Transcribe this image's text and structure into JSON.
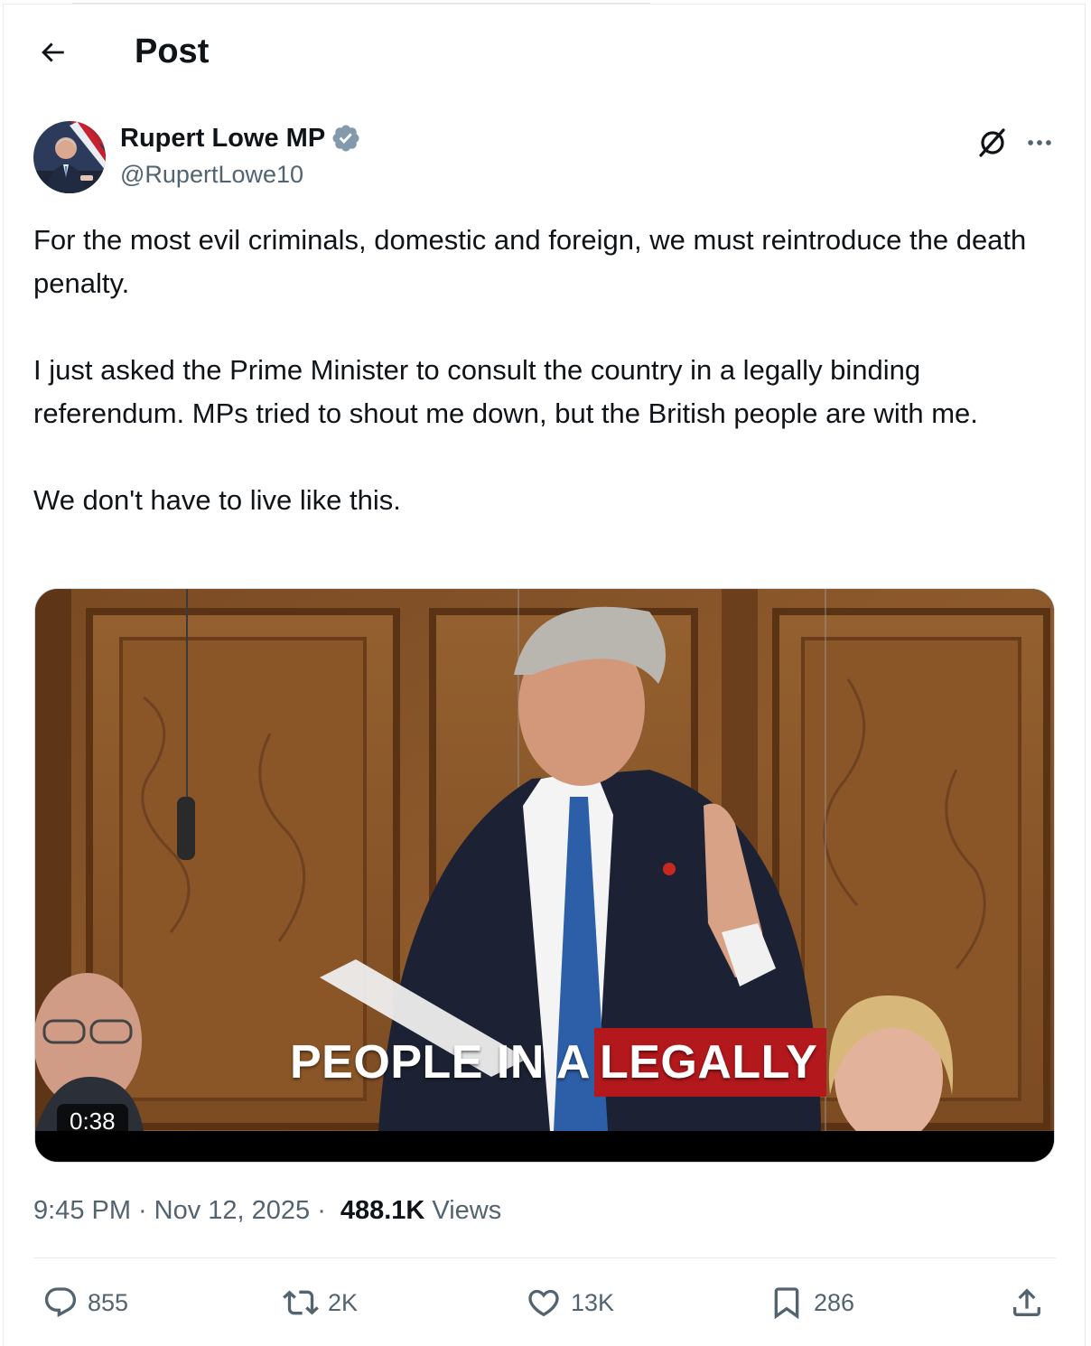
{
  "header": {
    "title": "Post",
    "back_icon": "arrow-left-icon"
  },
  "author": {
    "display_name": "Rupert Lowe MP",
    "handle": "@RupertLowe10",
    "verified_color": "#829aab"
  },
  "tweet": {
    "paragraphs": [
      "For the most evil criminals, domestic and foreign, we must reintroduce the death penalty.",
      "I just asked the Prime Minister to consult the country in a legally binding referendum. MPs tried to shout me down, but the British people are with me.",
      "We don't have to live like this."
    ]
  },
  "media": {
    "caption_plain": "PEOPLE IN A",
    "caption_highlight": "LEGALLY",
    "highlight_color": "#b3181c",
    "duration": "0:38"
  },
  "meta": {
    "time": "9:45 PM",
    "date": "Nov 12, 2025",
    "views_count": "488.1K",
    "views_label": "Views"
  },
  "actions": {
    "replies": "855",
    "reposts": "2K",
    "likes": "13K",
    "bookmarks": "286"
  },
  "colors": {
    "text": "#0f1419",
    "secondary": "#536471",
    "border": "#e6ebee"
  }
}
